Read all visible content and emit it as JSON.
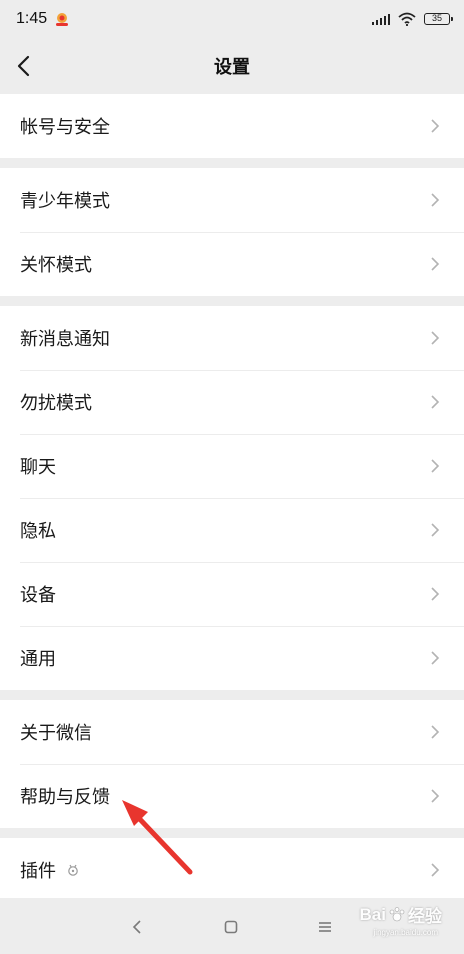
{
  "status_bar": {
    "time": "1:45",
    "battery": "35"
  },
  "header": {
    "title": "设置"
  },
  "groups": [
    {
      "items": [
        {
          "label": "帐号与安全"
        }
      ]
    },
    {
      "items": [
        {
          "label": "青少年模式"
        },
        {
          "label": "关怀模式"
        }
      ]
    },
    {
      "items": [
        {
          "label": "新消息通知"
        },
        {
          "label": "勿扰模式"
        },
        {
          "label": "聊天"
        },
        {
          "label": "隐私"
        },
        {
          "label": "设备"
        },
        {
          "label": "通用"
        }
      ]
    },
    {
      "items": [
        {
          "label": "关于微信"
        },
        {
          "label": "帮助与反馈"
        }
      ]
    },
    {
      "items": [
        {
          "label": "插件"
        }
      ]
    }
  ],
  "watermark": {
    "text": "Bai",
    "text2": "经验",
    "sub": "jingyan.baidu.com"
  },
  "colors": {
    "background": "#ededed",
    "annotation_arrow": "#e8352e"
  }
}
